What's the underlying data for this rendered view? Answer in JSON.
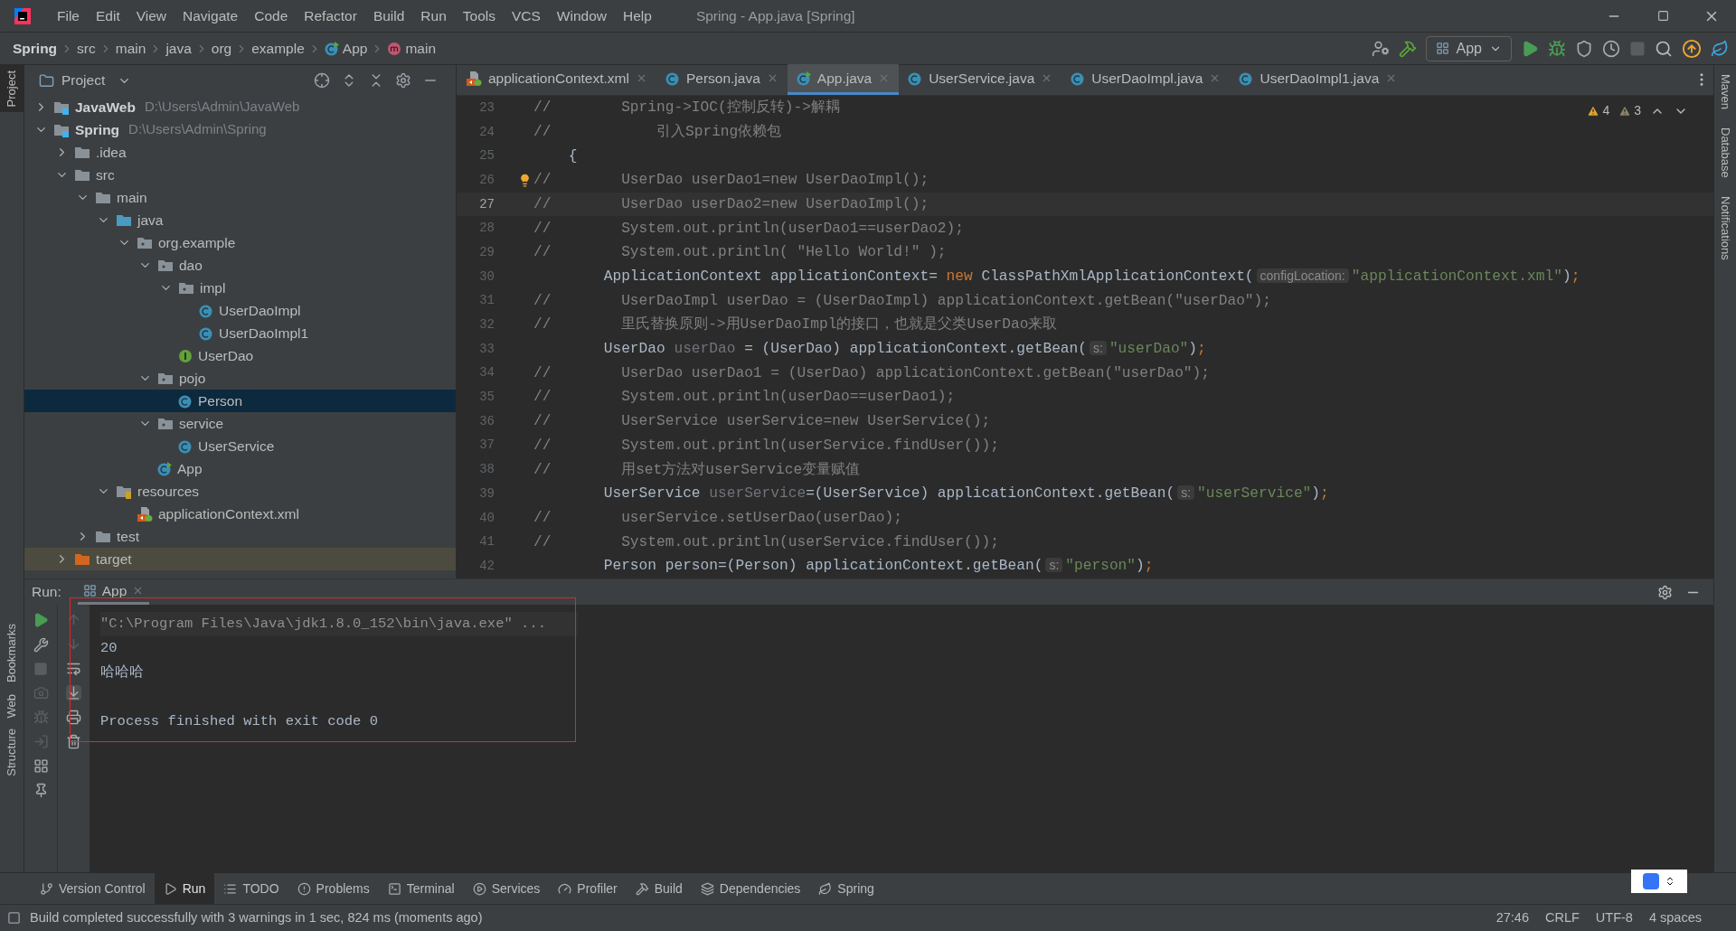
{
  "window": {
    "title": "Spring - App.java [Spring]"
  },
  "menu": [
    "File",
    "Edit",
    "View",
    "Navigate",
    "Code",
    "Refactor",
    "Build",
    "Run",
    "Tools",
    "VCS",
    "Window",
    "Help"
  ],
  "breadcrumbs": [
    {
      "label": "Spring",
      "kind": "project"
    },
    {
      "label": "src",
      "kind": "folder"
    },
    {
      "label": "main",
      "kind": "folder"
    },
    {
      "label": "java",
      "kind": "folder"
    },
    {
      "label": "org",
      "kind": "folder"
    },
    {
      "label": "example",
      "kind": "folder"
    },
    {
      "label": "App",
      "kind": "class"
    },
    {
      "label": "main",
      "kind": "method"
    }
  ],
  "run_config": "App",
  "left_stripe": [
    {
      "label": "Project",
      "selected": true
    },
    {
      "label": "Bookmarks",
      "selected": false
    },
    {
      "label": "Web",
      "selected": false
    },
    {
      "label": "Structure",
      "selected": false
    }
  ],
  "right_stripe": [
    "Maven",
    "Database",
    "Notifications"
  ],
  "project_panel": {
    "title": "Project",
    "tree": [
      {
        "label": "JavaWeb",
        "path": "D:\\Users\\Admin\\JavaWeb",
        "kind": "module",
        "expanded": false,
        "selected": false
      },
      {
        "label": "Spring",
        "path": "D:\\Users\\Admin\\Spring",
        "kind": "module",
        "expanded": true,
        "selected": false,
        "children": [
          {
            "label": ".idea",
            "kind": "folder",
            "expanded": false,
            "selected": false
          },
          {
            "label": "src",
            "kind": "folder",
            "expanded": true,
            "selected": false,
            "children": [
              {
                "label": "main",
                "kind": "folder",
                "expanded": true,
                "selected": false,
                "children": [
                  {
                    "label": "java",
                    "kind": "source",
                    "expanded": true,
                    "selected": false,
                    "children": [
                      {
                        "label": "org.example",
                        "kind": "package",
                        "expanded": true,
                        "selected": false,
                        "children": [
                          {
                            "label": "dao",
                            "kind": "package",
                            "expanded": true,
                            "selected": false,
                            "children": [
                              {
                                "label": "impl",
                                "kind": "package",
                                "expanded": true,
                                "selected": false,
                                "children": [
                                  {
                                    "label": "UserDaoImpl",
                                    "kind": "class",
                                    "selected": false
                                  },
                                  {
                                    "label": "UserDaoImpl1",
                                    "kind": "class",
                                    "selected": false
                                  }
                                ]
                              },
                              {
                                "label": "UserDao",
                                "kind": "interface",
                                "selected": false
                              }
                            ]
                          },
                          {
                            "label": "pojo",
                            "kind": "package",
                            "expanded": true,
                            "selected": false,
                            "children": [
                              {
                                "label": "Person",
                                "kind": "class",
                                "selected": true
                              }
                            ]
                          },
                          {
                            "label": "service",
                            "kind": "package",
                            "expanded": true,
                            "selected": false,
                            "children": [
                              {
                                "label": "UserService",
                                "kind": "class",
                                "selected": false
                              }
                            ]
                          },
                          {
                            "label": "App",
                            "kind": "main_class",
                            "selected": false
                          }
                        ]
                      }
                    ]
                  },
                  {
                    "label": "resources",
                    "kind": "resources",
                    "expanded": true,
                    "selected": false,
                    "children": [
                      {
                        "label": "applicationContext.xml",
                        "kind": "xml",
                        "selected": false
                      }
                    ]
                  }
                ]
              },
              {
                "label": "test",
                "kind": "folder",
                "expanded": false,
                "selected": false
              }
            ]
          },
          {
            "label": "target",
            "kind": "excluded",
            "expanded": false,
            "selected": false
          }
        ]
      }
    ]
  },
  "editor_tabs": [
    {
      "label": "applicationContext.xml",
      "kind": "xml",
      "selected": false
    },
    {
      "label": "Person.java",
      "kind": "class",
      "selected": false
    },
    {
      "label": "App.java",
      "kind": "main_class",
      "selected": true
    },
    {
      "label": "UserService.java",
      "kind": "class",
      "selected": false
    },
    {
      "label": "UserDaoImpl.java",
      "kind": "class",
      "selected": false
    },
    {
      "label": "UserDaoImpl1.java",
      "kind": "class",
      "selected": false
    }
  ],
  "inspections": {
    "warnings": "4",
    "weak_warnings": "3"
  },
  "code": [
    {
      "number": "23",
      "current": false,
      "bulb": false,
      "segments": [
        {
          "kind": "comment",
          "text": "//        Spring->IOC(控制反转)->解耦"
        }
      ]
    },
    {
      "number": "24",
      "current": false,
      "bulb": false,
      "segments": [
        {
          "kind": "comment",
          "text": "//            引入Spring依赖包"
        }
      ]
    },
    {
      "number": "25",
      "current": false,
      "bulb": false,
      "segments": [
        {
          "kind": "plain",
          "text": "    {"
        }
      ]
    },
    {
      "number": "26",
      "current": false,
      "bulb": true,
      "segments": [
        {
          "kind": "comment",
          "text": "//        UserDao userDao1=new UserDaoImpl();"
        }
      ]
    },
    {
      "number": "27",
      "current": true,
      "bulb": false,
      "segments": [
        {
          "kind": "comment",
          "text": "//        UserDao userDao2=new UserDaoImpl();"
        }
      ]
    },
    {
      "number": "28",
      "current": false,
      "bulb": false,
      "segments": [
        {
          "kind": "comment",
          "text": "//        System.out.println(userDao1==userDao2);"
        }
      ]
    },
    {
      "number": "29",
      "current": false,
      "bulb": false,
      "segments": [
        {
          "kind": "comment",
          "text": "//        System.out.println( \"Hello World!\" );"
        }
      ]
    },
    {
      "number": "30",
      "current": false,
      "bulb": false,
      "segments": [
        {
          "kind": "plain",
          "text": "        ApplicationContext applicationContext= "
        },
        {
          "kind": "keyword",
          "text": "new"
        },
        {
          "kind": "plain",
          "text": " ClassPathXmlApplicationContext("
        },
        {
          "kind": "hint",
          "text": "configLocation:"
        },
        {
          "kind": "string",
          "text": "\"applicationContext.xml\""
        },
        {
          "kind": "plain",
          "text": ")"
        },
        {
          "kind": "keyword",
          "text": ";"
        }
      ]
    },
    {
      "number": "31",
      "current": false,
      "bulb": false,
      "segments": [
        {
          "kind": "comment",
          "text": "//        UserDaoImpl userDao = (UserDaoImpl) applicationContext.getBean(\"userDao\");"
        }
      ]
    },
    {
      "number": "32",
      "current": false,
      "bulb": false,
      "segments": [
        {
          "kind": "comment",
          "text": "//        里氏替换原则->用UserDaoImpl的接口，也就是父类UserDao来取"
        }
      ]
    },
    {
      "number": "33",
      "current": false,
      "bulb": false,
      "segments": [
        {
          "kind": "plain",
          "text": "        UserDao "
        },
        {
          "kind": "unused",
          "text": "userDao"
        },
        {
          "kind": "plain",
          "text": " = (UserDao) applicationContext.getBean("
        },
        {
          "kind": "hint",
          "text": "s:"
        },
        {
          "kind": "string",
          "text": "\"userDao\""
        },
        {
          "kind": "plain",
          "text": ")"
        },
        {
          "kind": "keyword",
          "text": ";"
        }
      ]
    },
    {
      "number": "34",
      "current": false,
      "bulb": false,
      "segments": [
        {
          "kind": "comment",
          "text": "//        UserDao userDao1 = (UserDao) applicationContext.getBean(\"userDao\");"
        }
      ]
    },
    {
      "number": "35",
      "current": false,
      "bulb": false,
      "segments": [
        {
          "kind": "comment",
          "text": "//        System.out.println(userDao==userDao1);"
        }
      ]
    },
    {
      "number": "36",
      "current": false,
      "bulb": false,
      "segments": [
        {
          "kind": "comment",
          "text": "//        UserService userService=new UserService();"
        }
      ]
    },
    {
      "number": "37",
      "current": false,
      "bulb": false,
      "segments": [
        {
          "kind": "comment",
          "text": "//        System.out.println(userService.findUser());"
        }
      ]
    },
    {
      "number": "38",
      "current": false,
      "bulb": false,
      "segments": [
        {
          "kind": "comment",
          "text": "//        用set方法对userService变量赋值"
        }
      ]
    },
    {
      "number": "39",
      "current": false,
      "bulb": false,
      "segments": [
        {
          "kind": "plain",
          "text": "        UserService "
        },
        {
          "kind": "unused",
          "text": "userService"
        },
        {
          "kind": "plain",
          "text": "=(UserService) applicationContext.getBean("
        },
        {
          "kind": "hint",
          "text": "s:"
        },
        {
          "kind": "string",
          "text": "\"userService\""
        },
        {
          "kind": "plain",
          "text": ")"
        },
        {
          "kind": "keyword",
          "text": ";"
        }
      ]
    },
    {
      "number": "40",
      "current": false,
      "bulb": false,
      "segments": [
        {
          "kind": "comment",
          "text": "//        userService.setUserDao(userDao);"
        }
      ]
    },
    {
      "number": "41",
      "current": false,
      "bulb": false,
      "segments": [
        {
          "kind": "comment",
          "text": "//        System.out.println(userService.findUser());"
        }
      ]
    },
    {
      "number": "42",
      "current": false,
      "bulb": false,
      "segments": [
        {
          "kind": "plain",
          "text": "        Person person=(Person) applicationContext.getBean("
        },
        {
          "kind": "hint",
          "text": "s:"
        },
        {
          "kind": "string",
          "text": "\"person\""
        },
        {
          "kind": "plain",
          "text": ")"
        },
        {
          "kind": "keyword",
          "text": ";"
        }
      ]
    }
  ],
  "run_panel": {
    "label": "Run:",
    "tab": "App",
    "output": [
      {
        "kind": "command",
        "text": "\"C:\\Program Files\\Java\\jdk1.8.0_152\\bin\\java.exe\" ..."
      },
      {
        "kind": "plain",
        "text": "20"
      },
      {
        "kind": "plain",
        "text": "哈哈哈"
      },
      {
        "kind": "exit",
        "text": "Process finished with exit code 0"
      }
    ]
  },
  "bottom_tools": [
    {
      "label": "Version Control",
      "selected": false
    },
    {
      "label": "Run",
      "selected": true
    },
    {
      "label": "TODO",
      "selected": false
    },
    {
      "label": "Problems",
      "selected": false
    },
    {
      "label": "Terminal",
      "selected": false
    },
    {
      "label": "Services",
      "selected": false
    },
    {
      "label": "Profiler",
      "selected": false
    },
    {
      "label": "Build",
      "selected": false
    },
    {
      "label": "Dependencies",
      "selected": false
    },
    {
      "label": "Spring",
      "selected": false
    }
  ],
  "status_bar": {
    "message": "Build completed successfully with 3 warnings in 1 sec, 824 ms (moments ago)",
    "position": "27:46",
    "line_separator": "CRLF",
    "encoding": "UTF-8",
    "indent": "4 spaces"
  }
}
